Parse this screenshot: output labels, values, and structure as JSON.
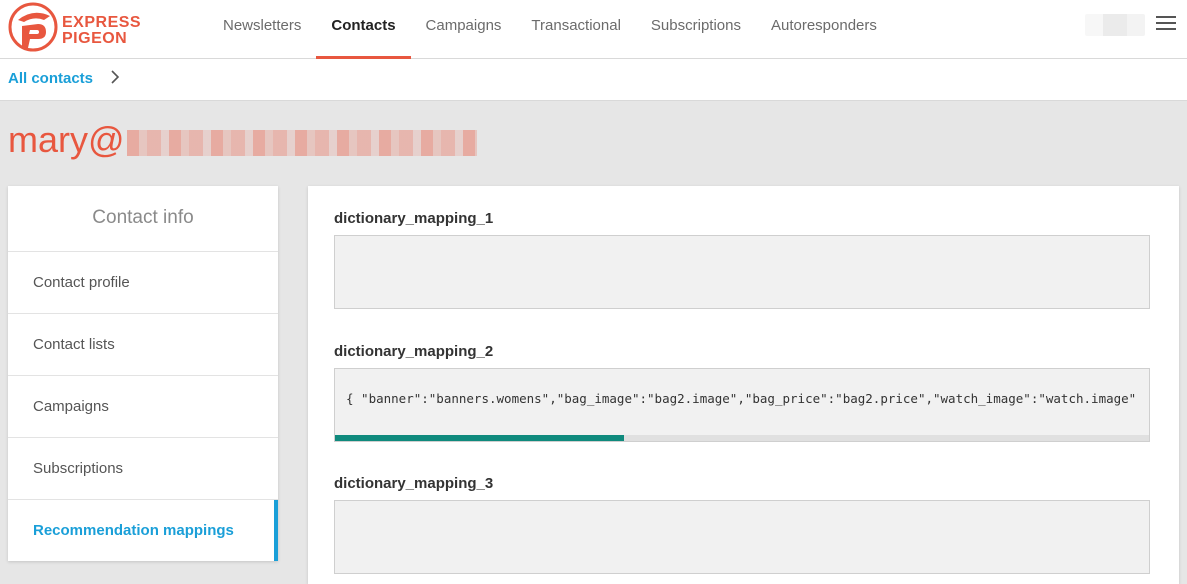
{
  "brand": {
    "logo_line1": "EXPRESS",
    "logo_line2": "PIGEON",
    "accent_color": "#e8573f",
    "link_color": "#1a9fd8",
    "scroll_color": "#0f8a7d"
  },
  "nav": {
    "items": [
      {
        "label": "Newsletters",
        "active": false
      },
      {
        "label": "Contacts",
        "active": true
      },
      {
        "label": "Campaigns",
        "active": false
      },
      {
        "label": "Transactional",
        "active": false
      },
      {
        "label": "Subscriptions",
        "active": false
      },
      {
        "label": "Autoresponders",
        "active": false
      }
    ],
    "menu_icon": "hamburger-menu-icon"
  },
  "breadcrumb": {
    "link": "All contacts",
    "separator_icon": "chevron-right-icon"
  },
  "page": {
    "title_prefix": "mary@"
  },
  "sidebar": {
    "title": "Contact info",
    "items": [
      {
        "label": "Contact profile",
        "active": false
      },
      {
        "label": "Contact lists",
        "active": false
      },
      {
        "label": "Campaigns",
        "active": false
      },
      {
        "label": "Subscriptions",
        "active": false
      },
      {
        "label": "Recommendation mappings",
        "active": true
      }
    ]
  },
  "main": {
    "fields": [
      {
        "label": "dictionary_mapping_1",
        "value": ""
      },
      {
        "label": "dictionary_mapping_2",
        "value": "{ \"banner\":\"banners.womens\",\"bag_image\":\"bag2.image\",\"bag_price\":\"bag2.price\",\"watch_image\":\"watch.image\"",
        "scroll_fraction": 0.355
      },
      {
        "label": "dictionary_mapping_3",
        "value": ""
      }
    ]
  }
}
